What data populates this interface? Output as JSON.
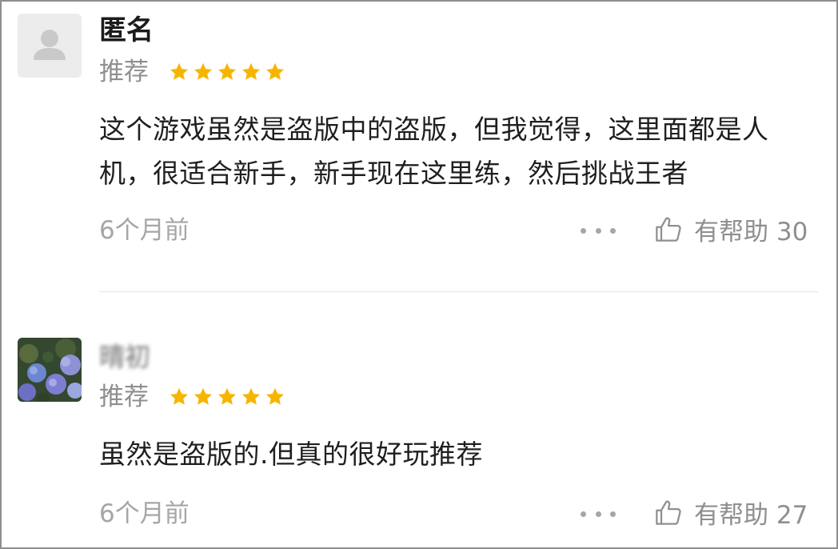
{
  "reviews": [
    {
      "username": "匿名",
      "tag": "推荐",
      "rating": 5,
      "text": "这个游戏虽然是盗版中的盗版，但我觉得，这里面都是人机，很适合新手，新手现在这里练，然后挑战王者",
      "time": "6个月前",
      "helpful_label": "有帮助 30"
    },
    {
      "username": "晴初",
      "tag": "推荐",
      "rating": 5,
      "text": "虽然是盗版的.但真的很好玩推荐",
      "time": "6个月前",
      "helpful_label": "有帮助 27"
    }
  ],
  "colors": {
    "star": "#f7b500",
    "muted": "#8f8f8f",
    "text": "#1f1f1f"
  }
}
